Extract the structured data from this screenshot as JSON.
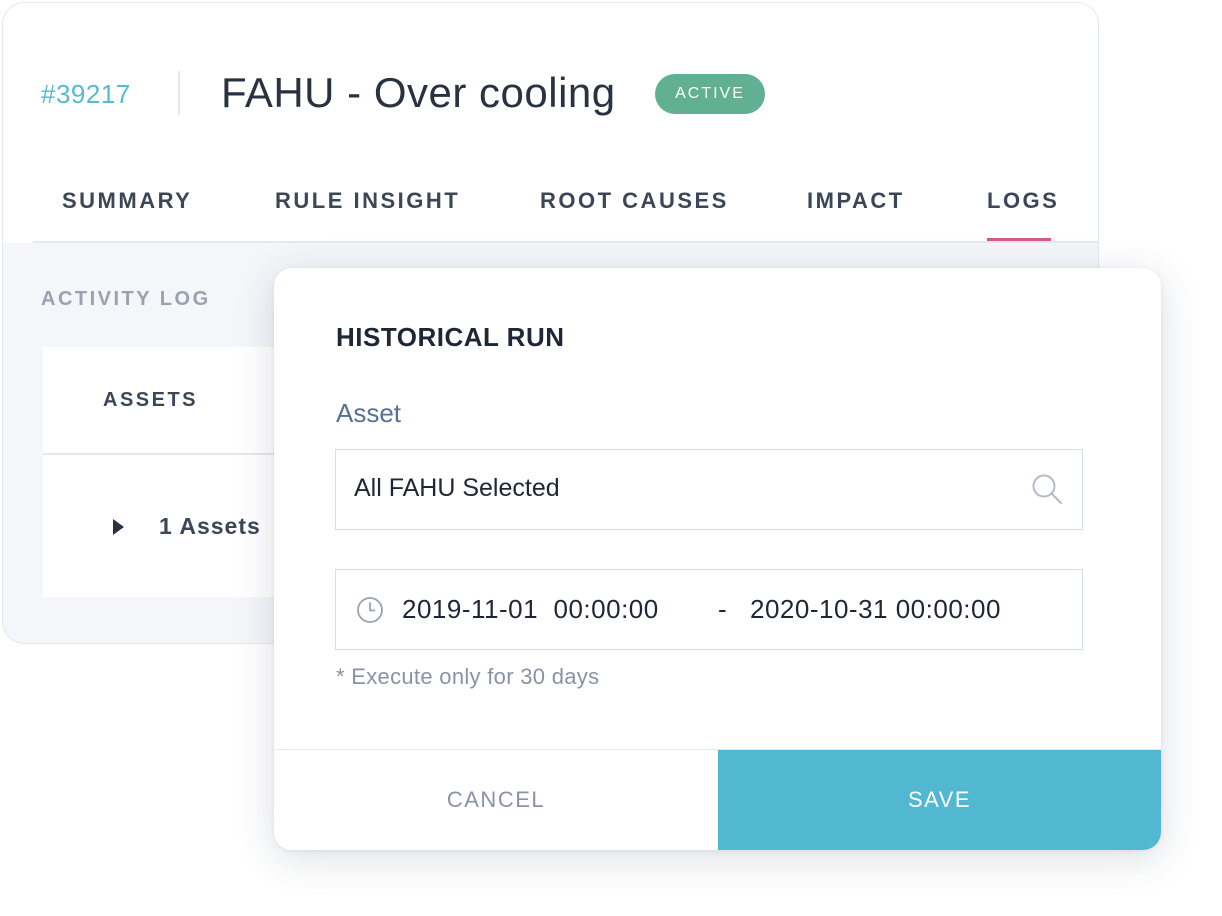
{
  "issue": {
    "id": "#39217",
    "title": "FAHU - Over cooling",
    "status": "ACTIVE"
  },
  "tabs": [
    {
      "label": "SUMMARY"
    },
    {
      "label": "RULE INSIGHT"
    },
    {
      "label": "ROOT CAUSES"
    },
    {
      "label": "IMPACT"
    },
    {
      "label": "LOGS",
      "active": true
    }
  ],
  "activity_log": {
    "label": "ACTIVITY LOG",
    "table": {
      "header": "ASSETS",
      "rows": [
        {
          "label": "1 Assets"
        }
      ]
    }
  },
  "modal": {
    "title": "HISTORICAL RUN",
    "asset_label": "Asset",
    "asset_value": "All FAHU Selected",
    "date_start": "2019-11-01  00:00:00",
    "date_separator": "-",
    "date_end": "2020-10-31 00:00:00",
    "hint": "* Execute only for 30 days",
    "cancel_label": "CANCEL",
    "save_label": "SAVE"
  },
  "colors": {
    "accent": "#52b8d2",
    "status_active": "#62b094",
    "tab_active_underline": "#d85a82",
    "issue_id": "#58b9d1"
  },
  "icons": {
    "asset_search": "search-icon",
    "date_range": "clock-icon",
    "row_expand": "caret-right-icon"
  }
}
